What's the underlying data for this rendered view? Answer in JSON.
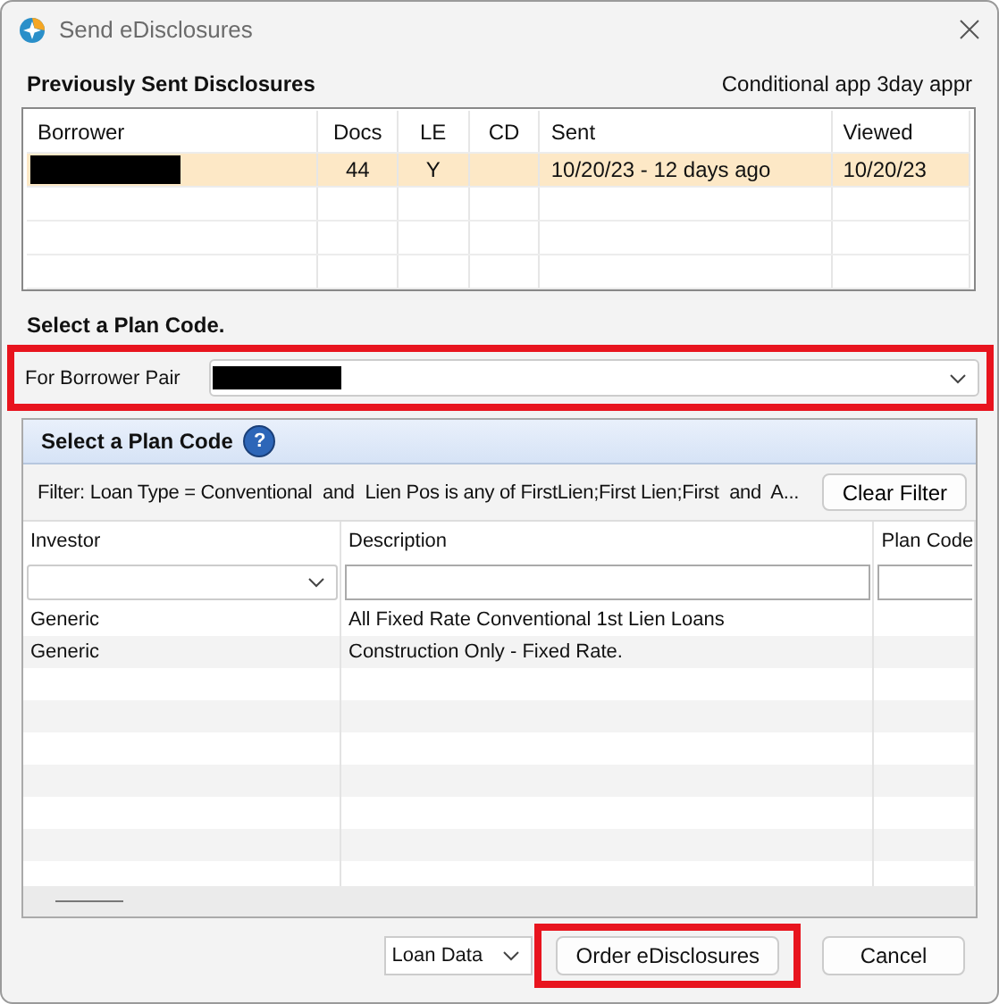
{
  "window": {
    "title": "Send eDisclosures"
  },
  "previous": {
    "title": "Previously Sent Disclosures",
    "status": "Conditional app 3day appr",
    "columns": [
      "Borrower",
      "Docs",
      "LE",
      "CD",
      "Sent",
      "Viewed"
    ],
    "rows": [
      {
        "selected": true,
        "borrower_redacted": true,
        "docs": "44",
        "le": "Y",
        "sent": "10/20/23 - 12 days ago",
        "viewed": "10/20/23"
      }
    ]
  },
  "plan": {
    "heading": "Select a Plan Code.",
    "borrower_pair": {
      "label": "For Borrower Pair",
      "value_redacted": true,
      "highlighted": true
    },
    "panel": {
      "title": "Select a Plan Code",
      "help": "?",
      "filter": "Filter: Loan Type = Conventional  and  Lien Pos is any of FirstLien;First Lien;First  and  A...",
      "clear_button": "Clear Filter",
      "columns": [
        "Investor",
        "Description",
        "Plan Code"
      ],
      "rows": [
        {
          "investor": "Generic",
          "description": "All Fixed Rate Conventional 1st Lien Loans"
        },
        {
          "investor": "Generic",
          "description": "Construction Only - Fixed Rate."
        }
      ]
    }
  },
  "footer": {
    "loan_data": "Loan Data",
    "order": {
      "label": "Order eDisclosures",
      "highlighted": true
    },
    "cancel": "Cancel"
  }
}
